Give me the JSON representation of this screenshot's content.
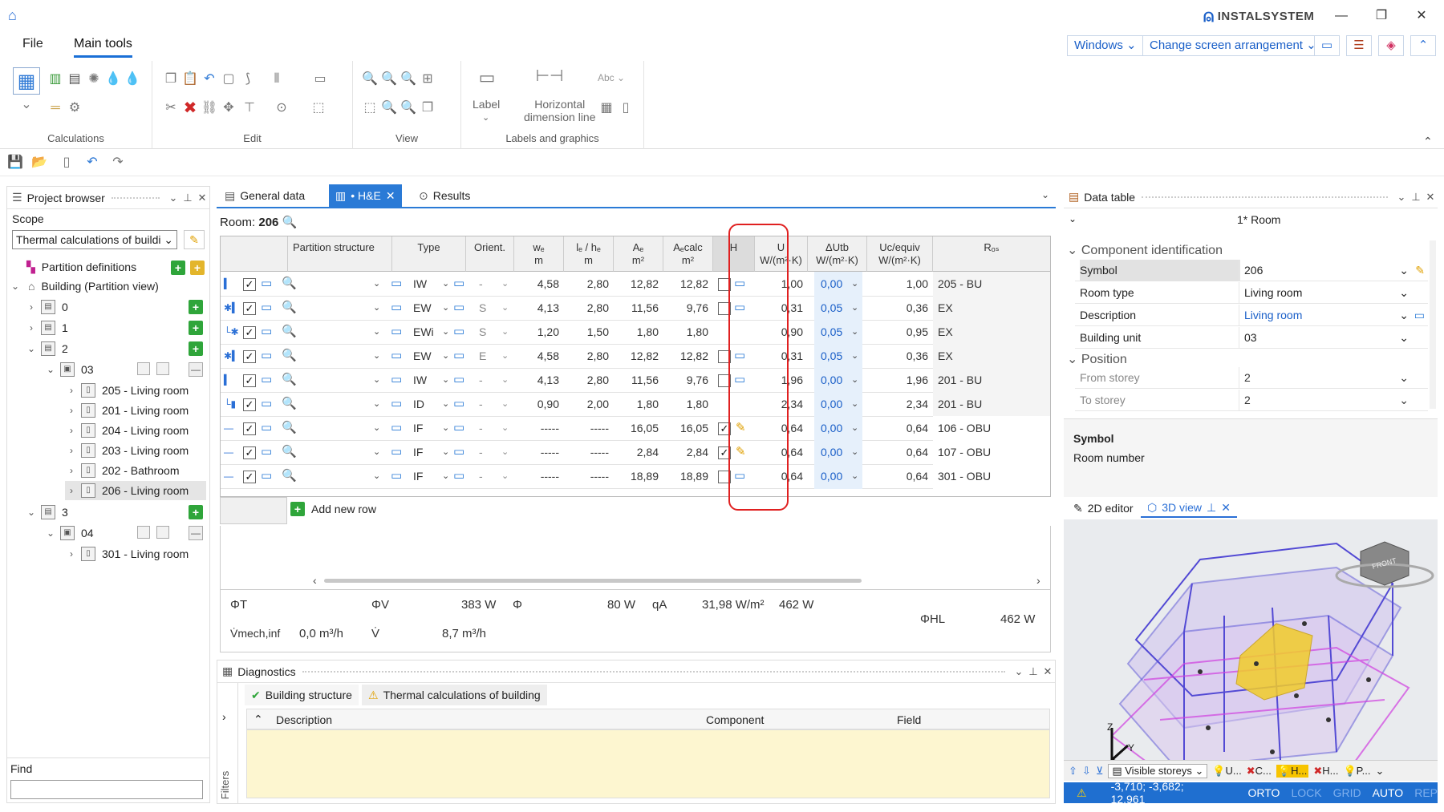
{
  "app": {
    "brand": "INSTALSYSTEM"
  },
  "menu": {
    "file": "File",
    "main_tools": "Main tools"
  },
  "top_buttons": {
    "windows": "Windows",
    "change_screen": "Change screen arrangement"
  },
  "ribbon": {
    "groups": [
      "Calculations",
      "Edit",
      "View",
      "Labels and graphics"
    ],
    "label_btn": "Label",
    "hdim_btn_1": "Horizontal",
    "hdim_btn_2": "dimension line",
    "abc": "Abc"
  },
  "project_browser": {
    "title": "Project browser",
    "scope_label": "Scope",
    "scope_value": "Thermal calculations of buildi",
    "find_label": "Find",
    "tree": {
      "partition_defs": "Partition definitions",
      "building": "Building (Partition view)",
      "s0": "0",
      "s1": "1",
      "s2": "2",
      "u03": "03",
      "r205": "205 - Living room",
      "r201": "201 - Living room",
      "r204": "204 - Living room",
      "r203": "203 - Living room",
      "r202": "202 - Bathroom",
      "r206": "206 - Living room",
      "s3": "3",
      "u04": "04",
      "r301": "301 - Living room"
    }
  },
  "tabs": {
    "general": "General data",
    "he": "• H&E",
    "results": "Results"
  },
  "room": {
    "label": "Room:",
    "number": "206"
  },
  "grid": {
    "headers": {
      "partition": "Partition structure",
      "type": "Type",
      "orient": "Orient.",
      "we": "wₑ",
      "we_u": "m",
      "le": "lₑ / hₑ",
      "le_u": "m",
      "ae": "Aₑ",
      "ae_u": "m²",
      "acalc": "Aₑcalc",
      "acalc_u": "m²",
      "h": "H",
      "u": "U",
      "u_u": "W/(m²·K)",
      "dutb": "ΔUtb",
      "dutb_u": "W/(m²·K)",
      "uc": "Uc/equiv",
      "uc_u": "W/(m²·K)",
      "ros": "Rₒₛ"
    },
    "rows": [
      {
        "type": "IW",
        "orient": "-",
        "we": "4,58",
        "le": "2,80",
        "ae": "12,82",
        "acalc": "12,82",
        "h": "mon",
        "u": "1,00",
        "dutb": "0,00",
        "uc": "1,00",
        "ros": "205 - BU"
      },
      {
        "type": "EW",
        "orient": "S",
        "we": "4,13",
        "le": "2,80",
        "ae": "11,56",
        "acalc": "9,76",
        "h": "mon",
        "u": "0,31",
        "dutb": "0,05",
        "uc": "0,36",
        "ros": "EX"
      },
      {
        "type": "EWi",
        "orient": "S",
        "we": "1,20",
        "le": "1,50",
        "ae": "1,80",
        "acalc": "1,80",
        "h": "none",
        "u": "0,90",
        "dutb": "0,05",
        "uc": "0,95",
        "ros": "EX"
      },
      {
        "type": "EW",
        "orient": "E",
        "we": "4,58",
        "le": "2,80",
        "ae": "12,82",
        "acalc": "12,82",
        "h": "mon",
        "u": "0,31",
        "dutb": "0,05",
        "uc": "0,36",
        "ros": "EX"
      },
      {
        "type": "IW",
        "orient": "-",
        "we": "4,13",
        "le": "2,80",
        "ae": "11,56",
        "acalc": "9,76",
        "h": "mon",
        "u": "1,96",
        "dutb": "0,00",
        "uc": "1,96",
        "ros": "201 - BU"
      },
      {
        "type": "ID",
        "orient": "-",
        "we": "0,90",
        "le": "2,00",
        "ae": "1,80",
        "acalc": "1,80",
        "h": "none",
        "u": "2,34",
        "dutb": "0,00",
        "uc": "2,34",
        "ros": "201 - BU"
      },
      {
        "type": "IF",
        "orient": "-",
        "we": "-----",
        "le": "-----",
        "ae": "16,05",
        "acalc": "16,05",
        "h": "pen",
        "u": "0,64",
        "dutb": "0,00",
        "uc": "0,64",
        "ros": "106 - OBU"
      },
      {
        "type": "IF",
        "orient": "-",
        "we": "-----",
        "le": "-----",
        "ae": "2,84",
        "acalc": "2,84",
        "h": "pen",
        "u": "0,64",
        "dutb": "0,00",
        "uc": "0,64",
        "ros": "107 - OBU"
      },
      {
        "type": "IF",
        "orient": "-",
        "we": "-----",
        "le": "-----",
        "ae": "18,89",
        "acalc": "18,89",
        "h": "mon",
        "u": "0,64",
        "dutb": "0,00",
        "uc": "0,64",
        "ros": "301 - OBU"
      }
    ],
    "add_row": "Add new row"
  },
  "summary": {
    "phi_t_lbl": "ΦT",
    "phi_t": "383 W",
    "phi_v_lbl": "ΦV",
    "phi_v": "80 W",
    "phi_lbl": "Φ",
    "phi": "462 W",
    "qa_lbl": "qA",
    "qa": "31,98 W/m²",
    "vmech_lbl": "V̇mech,inf",
    "vmech": "0,0 m³/h",
    "v_lbl": "V̇",
    "v": "8,7 m³/h",
    "phl_lbl": "ΦHL",
    "phl": "462 W"
  },
  "diagnostics": {
    "title": "Diagnostics",
    "tab1": "Building structure",
    "tab2": "Thermal calculations of building",
    "col_desc": "Description",
    "col_comp": "Component",
    "col_field": "Field",
    "filters": "Filters"
  },
  "data_table": {
    "title": "Data table",
    "room_sel": "1* Room",
    "sect_comp": "Component identification",
    "symbol_k": "Symbol",
    "symbol_v": "206",
    "roomtype_k": "Room type",
    "roomtype_v": "Living room",
    "desc_k": "Description",
    "desc_v": "Living room",
    "bu_k": "Building unit",
    "bu_v": "03",
    "sect_pos": "Position",
    "from_k": "From storey",
    "from_v": "2",
    "to_k": "To storey",
    "to_v": "2",
    "help_title": "Symbol",
    "help_text": "Room number"
  },
  "view3d": {
    "tab_2d": "2D editor",
    "tab_3d": "3D view",
    "visible_storeys": "Visible storeys",
    "t_u": "U...",
    "t_c": "C...",
    "t_h1": "H...",
    "t_h2": "H...",
    "t_p": "P...",
    "cube_label": "FRONT",
    "ax_z": "Z",
    "ax_y": "Y",
    "ax_x": "X"
  },
  "statusbar": {
    "coords": "-3,710; -3,682; 12,961",
    "orto": "ORTO",
    "lock": "LOCK",
    "grid": "GRID",
    "auto": "AUTO",
    "rep": "REP"
  }
}
